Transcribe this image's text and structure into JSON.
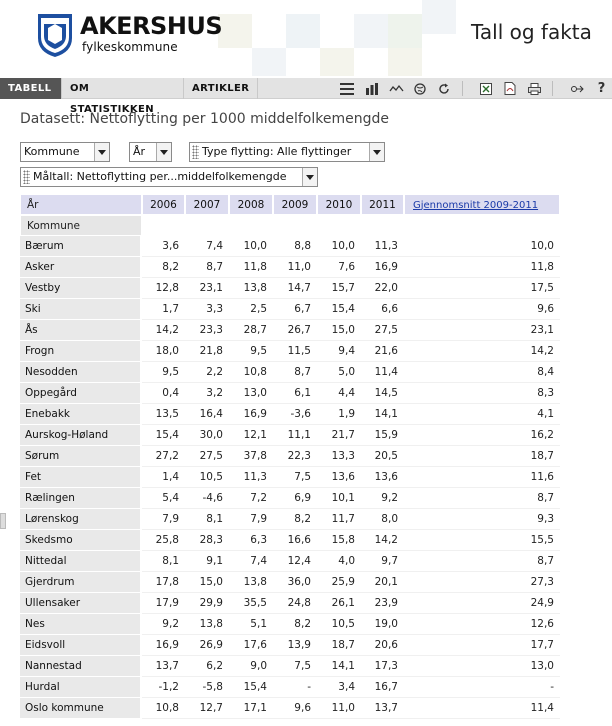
{
  "header": {
    "logo_name": "AKERSHUS",
    "logo_sub": "fylkeskommune",
    "heading": "Tall og fakta"
  },
  "toolbar": {
    "tabs": [
      {
        "label": "TABELL",
        "active": true
      },
      {
        "label": "OM STATISTIKKEN",
        "active": false
      },
      {
        "label": "ARTIKLER",
        "active": false
      }
    ],
    "icons": [
      "table-view-icon",
      "bar-chart-icon",
      "map-icon",
      "globe-icon",
      "refresh-icon",
      "excel-export-icon",
      "pdf-export-icon",
      "print-icon",
      "settings-icon",
      "help-icon"
    ]
  },
  "dataset": {
    "title": "Datasett: Nettoflytting per 1000 middelfolkemengde"
  },
  "filters": {
    "kommune": "Kommune",
    "ar": "År",
    "type": "Type flytting: Alle flyttinger",
    "maltall": "Måltall: Nettoflytting per...middelfolkemengde"
  },
  "table": {
    "corner_label": "År",
    "row_label": "Kommune",
    "years": [
      "2006",
      "2007",
      "2008",
      "2009",
      "2010",
      "2011"
    ],
    "avg_header": "Gjennomsnitt 2009-2011",
    "rows": [
      {
        "name": "Bærum",
        "values": [
          "3,6",
          "7,4",
          "10,0",
          "8,8",
          "10,0",
          "11,3"
        ],
        "avg": "10,0"
      },
      {
        "name": "Asker",
        "values": [
          "8,2",
          "8,7",
          "11,8",
          "11,0",
          "7,6",
          "16,9"
        ],
        "avg": "11,8"
      },
      {
        "name": "Vestby",
        "values": [
          "12,8",
          "23,1",
          "13,8",
          "14,7",
          "15,7",
          "22,0"
        ],
        "avg": "17,5"
      },
      {
        "name": "Ski",
        "values": [
          "1,7",
          "3,3",
          "2,5",
          "6,7",
          "15,4",
          "6,6"
        ],
        "avg": "9,6"
      },
      {
        "name": "Ås",
        "values": [
          "14,2",
          "23,3",
          "28,7",
          "26,7",
          "15,0",
          "27,5"
        ],
        "avg": "23,1"
      },
      {
        "name": "Frogn",
        "values": [
          "18,0",
          "21,8",
          "9,5",
          "11,5",
          "9,4",
          "21,6"
        ],
        "avg": "14,2"
      },
      {
        "name": "Nesodden",
        "values": [
          "9,5",
          "2,2",
          "10,8",
          "8,7",
          "5,0",
          "11,4"
        ],
        "avg": "8,4"
      },
      {
        "name": "Oppegård",
        "values": [
          "0,4",
          "3,2",
          "13,0",
          "6,1",
          "4,4",
          "14,5"
        ],
        "avg": "8,3"
      },
      {
        "name": "Enebakk",
        "values": [
          "13,5",
          "16,4",
          "16,9",
          "-3,6",
          "1,9",
          "14,1"
        ],
        "avg": "4,1"
      },
      {
        "name": "Aurskog-Høland",
        "values": [
          "15,4",
          "30,0",
          "12,1",
          "11,1",
          "21,7",
          "15,9"
        ],
        "avg": "16,2"
      },
      {
        "name": "Sørum",
        "values": [
          "27,2",
          "27,5",
          "37,8",
          "22,3",
          "13,3",
          "20,5"
        ],
        "avg": "18,7"
      },
      {
        "name": "Fet",
        "values": [
          "1,4",
          "10,5",
          "11,3",
          "7,5",
          "13,6",
          "13,6"
        ],
        "avg": "11,6"
      },
      {
        "name": "Rælingen",
        "values": [
          "5,4",
          "-4,6",
          "7,2",
          "6,9",
          "10,1",
          "9,2"
        ],
        "avg": "8,7"
      },
      {
        "name": "Lørenskog",
        "values": [
          "7,9",
          "8,1",
          "7,9",
          "8,2",
          "11,7",
          "8,0"
        ],
        "avg": "9,3"
      },
      {
        "name": "Skedsmo",
        "values": [
          "25,8",
          "28,3",
          "6,3",
          "16,6",
          "15,8",
          "14,2"
        ],
        "avg": "15,5"
      },
      {
        "name": "Nittedal",
        "values": [
          "8,1",
          "9,1",
          "7,4",
          "12,4",
          "4,0",
          "9,7"
        ],
        "avg": "8,7"
      },
      {
        "name": "Gjerdrum",
        "values": [
          "17,8",
          "15,0",
          "13,8",
          "36,0",
          "25,9",
          "20,1"
        ],
        "avg": "27,3"
      },
      {
        "name": "Ullensaker",
        "values": [
          "17,9",
          "29,9",
          "35,5",
          "24,8",
          "26,1",
          "23,9"
        ],
        "avg": "24,9"
      },
      {
        "name": "Nes",
        "values": [
          "9,2",
          "13,8",
          "5,1",
          "8,2",
          "10,5",
          "19,0"
        ],
        "avg": "12,6"
      },
      {
        "name": "Eidsvoll",
        "values": [
          "16,9",
          "26,9",
          "17,6",
          "13,9",
          "18,7",
          "20,6"
        ],
        "avg": "17,7"
      },
      {
        "name": "Nannestad",
        "values": [
          "13,7",
          "6,2",
          "9,0",
          "7,5",
          "14,1",
          "17,3"
        ],
        "avg": "13,0"
      },
      {
        "name": "Hurdal",
        "values": [
          "-1,2",
          "-5,8",
          "15,4",
          "-",
          "3,4",
          "16,7"
        ],
        "avg": "-"
      },
      {
        "name": "Oslo kommune",
        "values": [
          "10,8",
          "12,7",
          "17,1",
          "9,6",
          "11,0",
          "13,7"
        ],
        "avg": "11,4"
      }
    ]
  },
  "colors": {
    "toolbar_bg": "#e3e3e3",
    "active_tab_bg": "#555555",
    "column_header_bg": "#dcdcf0",
    "row_header_bg": "#e9e9e9",
    "link": "#1a3aa8",
    "logo_blue": "#1d4fa0"
  }
}
